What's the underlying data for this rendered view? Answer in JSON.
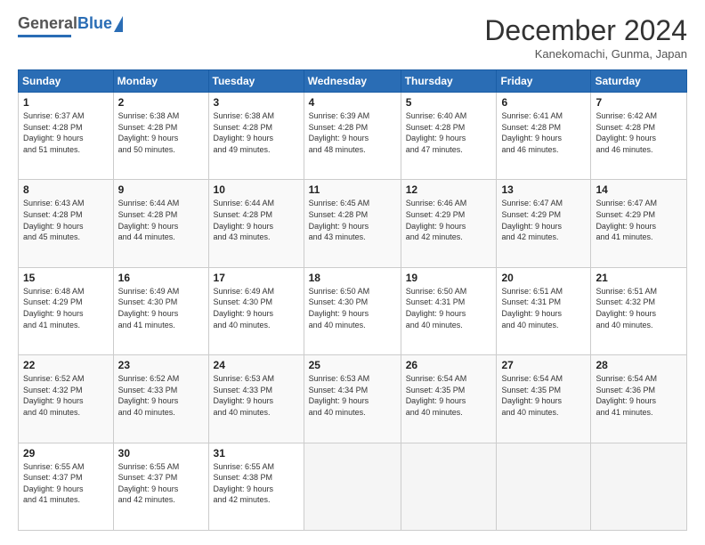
{
  "logo": {
    "general": "General",
    "blue": "Blue"
  },
  "header": {
    "month": "December 2024",
    "location": "Kanekomachi, Gunma, Japan"
  },
  "days_of_week": [
    "Sunday",
    "Monday",
    "Tuesday",
    "Wednesday",
    "Thursday",
    "Friday",
    "Saturday"
  ],
  "weeks": [
    [
      {
        "day": "1",
        "sunrise": "6:37 AM",
        "sunset": "4:28 PM",
        "daylight": "9 hours and 51 minutes."
      },
      {
        "day": "2",
        "sunrise": "6:38 AM",
        "sunset": "4:28 PM",
        "daylight": "9 hours and 50 minutes."
      },
      {
        "day": "3",
        "sunrise": "6:38 AM",
        "sunset": "4:28 PM",
        "daylight": "9 hours and 49 minutes."
      },
      {
        "day": "4",
        "sunrise": "6:39 AM",
        "sunset": "4:28 PM",
        "daylight": "9 hours and 48 minutes."
      },
      {
        "day": "5",
        "sunrise": "6:40 AM",
        "sunset": "4:28 PM",
        "daylight": "9 hours and 47 minutes."
      },
      {
        "day": "6",
        "sunrise": "6:41 AM",
        "sunset": "4:28 PM",
        "daylight": "9 hours and 46 minutes."
      },
      {
        "day": "7",
        "sunrise": "6:42 AM",
        "sunset": "4:28 PM",
        "daylight": "9 hours and 46 minutes."
      }
    ],
    [
      {
        "day": "8",
        "sunrise": "6:43 AM",
        "sunset": "4:28 PM",
        "daylight": "9 hours and 45 minutes."
      },
      {
        "day": "9",
        "sunrise": "6:44 AM",
        "sunset": "4:28 PM",
        "daylight": "9 hours and 44 minutes."
      },
      {
        "day": "10",
        "sunrise": "6:44 AM",
        "sunset": "4:28 PM",
        "daylight": "9 hours and 43 minutes."
      },
      {
        "day": "11",
        "sunrise": "6:45 AM",
        "sunset": "4:28 PM",
        "daylight": "9 hours and 43 minutes."
      },
      {
        "day": "12",
        "sunrise": "6:46 AM",
        "sunset": "4:29 PM",
        "daylight": "9 hours and 42 minutes."
      },
      {
        "day": "13",
        "sunrise": "6:47 AM",
        "sunset": "4:29 PM",
        "daylight": "9 hours and 42 minutes."
      },
      {
        "day": "14",
        "sunrise": "6:47 AM",
        "sunset": "4:29 PM",
        "daylight": "9 hours and 41 minutes."
      }
    ],
    [
      {
        "day": "15",
        "sunrise": "6:48 AM",
        "sunset": "4:29 PM",
        "daylight": "9 hours and 41 minutes."
      },
      {
        "day": "16",
        "sunrise": "6:49 AM",
        "sunset": "4:30 PM",
        "daylight": "9 hours and 41 minutes."
      },
      {
        "day": "17",
        "sunrise": "6:49 AM",
        "sunset": "4:30 PM",
        "daylight": "9 hours and 40 minutes."
      },
      {
        "day": "18",
        "sunrise": "6:50 AM",
        "sunset": "4:30 PM",
        "daylight": "9 hours and 40 minutes."
      },
      {
        "day": "19",
        "sunrise": "6:50 AM",
        "sunset": "4:31 PM",
        "daylight": "9 hours and 40 minutes."
      },
      {
        "day": "20",
        "sunrise": "6:51 AM",
        "sunset": "4:31 PM",
        "daylight": "9 hours and 40 minutes."
      },
      {
        "day": "21",
        "sunrise": "6:51 AM",
        "sunset": "4:32 PM",
        "daylight": "9 hours and 40 minutes."
      }
    ],
    [
      {
        "day": "22",
        "sunrise": "6:52 AM",
        "sunset": "4:32 PM",
        "daylight": "9 hours and 40 minutes."
      },
      {
        "day": "23",
        "sunrise": "6:52 AM",
        "sunset": "4:33 PM",
        "daylight": "9 hours and 40 minutes."
      },
      {
        "day": "24",
        "sunrise": "6:53 AM",
        "sunset": "4:33 PM",
        "daylight": "9 hours and 40 minutes."
      },
      {
        "day": "25",
        "sunrise": "6:53 AM",
        "sunset": "4:34 PM",
        "daylight": "9 hours and 40 minutes."
      },
      {
        "day": "26",
        "sunrise": "6:54 AM",
        "sunset": "4:35 PM",
        "daylight": "9 hours and 40 minutes."
      },
      {
        "day": "27",
        "sunrise": "6:54 AM",
        "sunset": "4:35 PM",
        "daylight": "9 hours and 40 minutes."
      },
      {
        "day": "28",
        "sunrise": "6:54 AM",
        "sunset": "4:36 PM",
        "daylight": "9 hours and 41 minutes."
      }
    ],
    [
      {
        "day": "29",
        "sunrise": "6:55 AM",
        "sunset": "4:37 PM",
        "daylight": "9 hours and 41 minutes."
      },
      {
        "day": "30",
        "sunrise": "6:55 AM",
        "sunset": "4:37 PM",
        "daylight": "9 hours and 42 minutes."
      },
      {
        "day": "31",
        "sunrise": "6:55 AM",
        "sunset": "4:38 PM",
        "daylight": "9 hours and 42 minutes."
      },
      null,
      null,
      null,
      null
    ]
  ]
}
